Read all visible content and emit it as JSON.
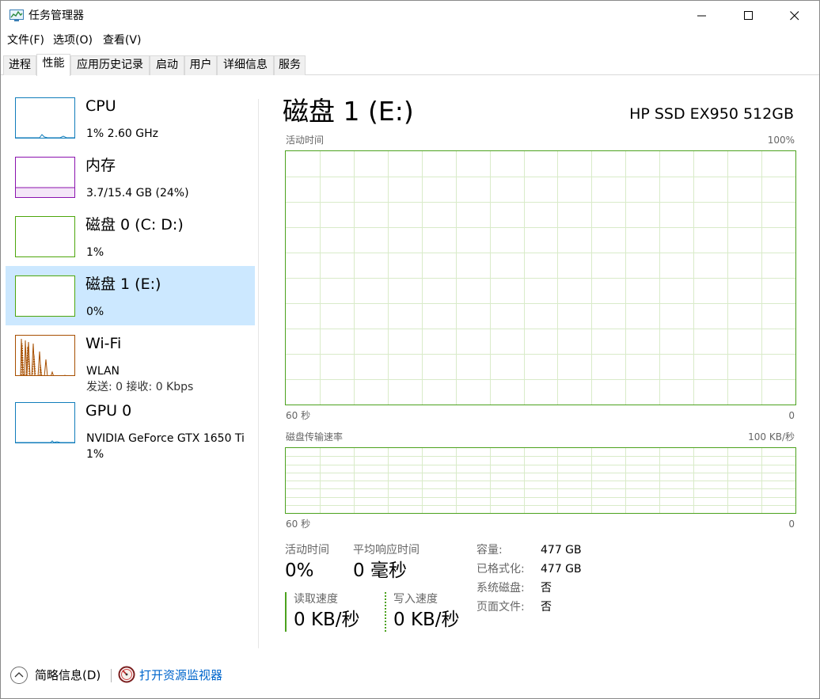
{
  "window": {
    "title": "任务管理器",
    "icon": "task-manager-icon"
  },
  "menu": [
    "文件(F)",
    "选项(O)",
    "查看(V)"
  ],
  "tabs": [
    {
      "label": "进程",
      "active": false
    },
    {
      "label": "性能",
      "active": true
    },
    {
      "label": "应用历史记录",
      "active": false
    },
    {
      "label": "启动",
      "active": false
    },
    {
      "label": "用户",
      "active": false
    },
    {
      "label": "详细信息",
      "active": false
    },
    {
      "label": "服务",
      "active": false
    }
  ],
  "devices": [
    {
      "name": "CPU",
      "line1": "1% 2.60 GHz",
      "color": "#117dbb",
      "selected": false
    },
    {
      "name": "内存",
      "line1": "3.7/15.4 GB (24%)",
      "color": "#8b12ae",
      "selected": false
    },
    {
      "name": "磁盘 0 (C: D:)",
      "line1": "1%",
      "color": "#4da60c",
      "selected": false
    },
    {
      "name": "磁盘 1 (E:)",
      "line1": "0%",
      "color": "#4da60c",
      "selected": true
    },
    {
      "name": "Wi-Fi",
      "line1": "WLAN",
      "line2": "发送: 0 接收: 0 Kbps",
      "color": "#a74f01",
      "selected": false
    },
    {
      "name": "GPU 0",
      "line1": "NVIDIA GeForce GTX 1650 Ti",
      "line2": "1%",
      "color": "#117dbb",
      "selected": false
    }
  ],
  "detail": {
    "title": "磁盘 1 (E:)",
    "model": "HP SSD EX950 512GB",
    "graph1": {
      "label": "活动时间",
      "max": "100%",
      "time": "60 秒",
      "min": "0"
    },
    "graph2": {
      "label": "磁盘传输速率",
      "max": "100 KB/秒",
      "time": "60 秒",
      "min": "0"
    },
    "stats": {
      "active_time_label": "活动时间",
      "active_time_value": "0%",
      "avg_response_label": "平均响应时间",
      "avg_response_value": "0 毫秒",
      "read_label": "读取速度",
      "read_value": "0 KB/秒",
      "write_label": "写入速度",
      "write_value": "0 KB/秒"
    },
    "props": [
      {
        "label": "容量:",
        "value": "477 GB"
      },
      {
        "label": "已格式化:",
        "value": "477 GB"
      },
      {
        "label": "系统磁盘:",
        "value": "否"
      },
      {
        "label": "页面文件:",
        "value": "否"
      }
    ]
  },
  "footer": {
    "fewer_details": "简略信息(D)",
    "resource_monitor": "打开资源监视器"
  },
  "colors": {
    "disk_green": "#4ca21e",
    "grid_green": "#d9ebc9",
    "selection": "#cce8ff",
    "link": "#0066cc"
  }
}
